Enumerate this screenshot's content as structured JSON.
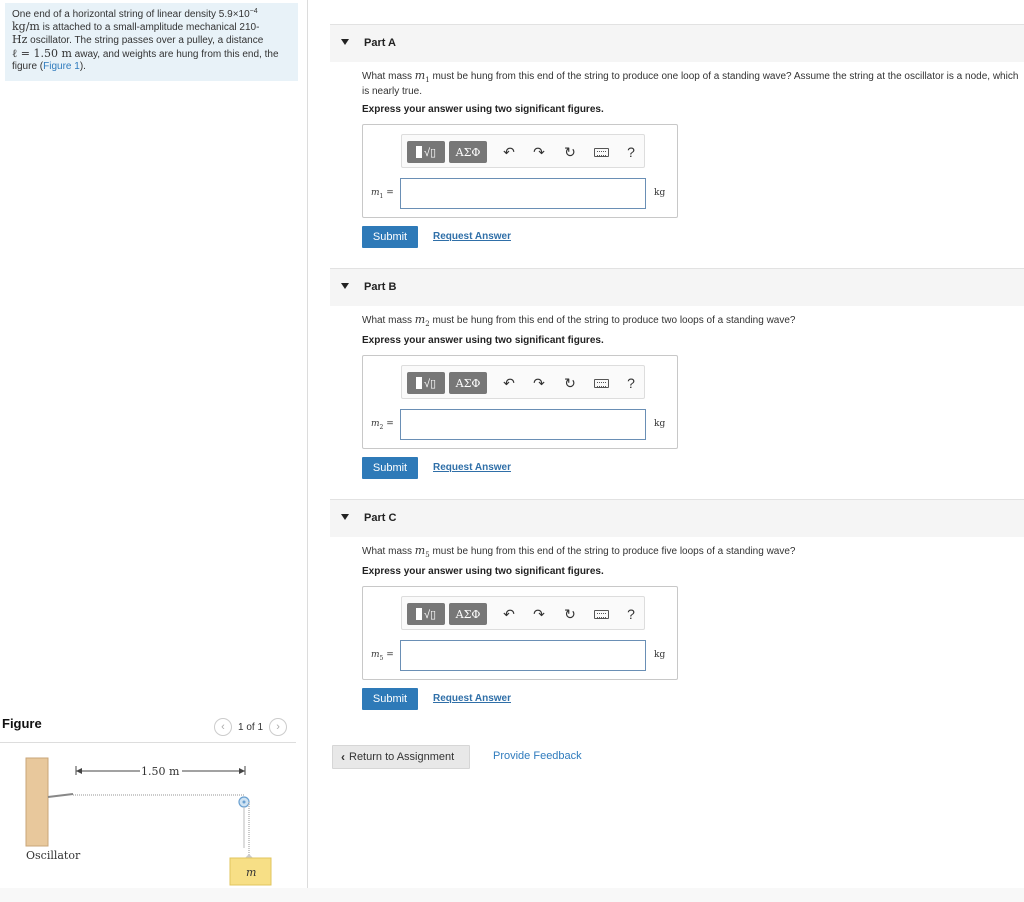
{
  "problem": {
    "line1": "One end of a horizontal string of linear density 5.9×10",
    "exp": "−4",
    "line2_math": "kg/m",
    "line2_rest": " is attached to a small-amplitude mechanical 210-",
    "line3_math": "Hz",
    "line3_rest": " oscillator. The string passes over a pulley, a distance",
    "line4_math": "ℓ = 1.50 m",
    "line4_rest": " away, and weights are hung from this end, the",
    "line5_pre": "figure (",
    "figure_link": "Figure 1",
    "line5_post": ")."
  },
  "figure": {
    "title": "Figure",
    "pager": "1 of 1",
    "prev_icon": "chevron-left-icon",
    "next_icon": "chevron-right-icon",
    "distance_label": "1.50 m",
    "oscillator_label": "Oscillator",
    "mass_label": "m"
  },
  "toolbar": {
    "template_icon": "template-icon",
    "greek_label": "ΑΣΦ",
    "undo_icon": "undo-icon",
    "redo_icon": "redo-icon",
    "reset_icon": "reset-icon",
    "keyboard_icon": "keyboard-icon",
    "help_label": "?"
  },
  "parts": [
    {
      "title": "Part A",
      "q_pre": "What mass ",
      "q_var": "m",
      "q_sub": "1",
      "q_post": " must be hung from this end of the string to produce one loop of a standing wave? Assume the string at the oscillator is a node, which is nearly true.",
      "express": "Express your answer using two significant figures.",
      "label_var": "m",
      "label_sub": "1",
      "label_eq": " =",
      "value": "",
      "unit": "kg",
      "submit": "Submit",
      "request": "Request Answer"
    },
    {
      "title": "Part B",
      "q_pre": "What mass ",
      "q_var": "m",
      "q_sub": "2",
      "q_post": " must be hung from this end of the string to produce two loops of a standing wave?",
      "express": "Express your answer using two significant figures.",
      "label_var": "m",
      "label_sub": "2",
      "label_eq": " =",
      "value": "",
      "unit": "kg",
      "submit": "Submit",
      "request": "Request Answer"
    },
    {
      "title": "Part C",
      "q_pre": "What mass ",
      "q_var": "m",
      "q_sub": "5",
      "q_post": " must be hung from this end of the string to produce five loops of a standing wave?",
      "express": "Express your answer using two significant figures.",
      "label_var": "m",
      "label_sub": "5",
      "label_eq": " =",
      "value": "",
      "unit": "kg",
      "submit": "Submit",
      "request": "Request Answer"
    }
  ],
  "footer": {
    "return_label": "Return to Assignment",
    "feedback_label": "Provide Feedback"
  }
}
